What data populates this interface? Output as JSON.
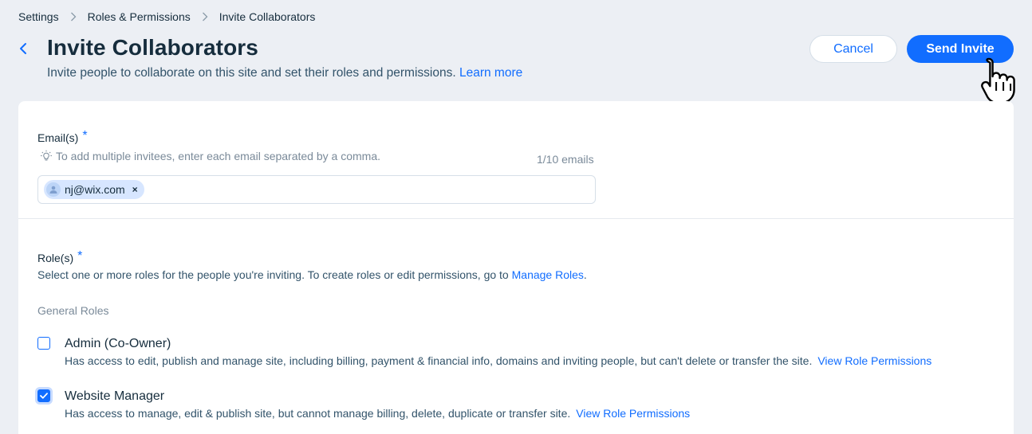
{
  "breadcrumb": [
    "Settings",
    "Roles & Permissions",
    "Invite Collaborators"
  ],
  "header": {
    "title": "Invite Collaborators",
    "subtitle": "Invite people to collaborate on this site and set their roles and permissions.",
    "learn_more": "Learn more",
    "cancel_label": "Cancel",
    "send_label": "Send Invite"
  },
  "emails": {
    "label": "Email(s)",
    "required_mark": "*",
    "hint": "To add multiple invitees, enter each email separated by a comma.",
    "counter": "1/10 emails",
    "chips": [
      "nj@wix.com"
    ],
    "chip_remove": "×"
  },
  "roles": {
    "label": "Role(s)",
    "required_mark": "*",
    "description": "Select one or more roles for the people you're inviting. To create roles or edit permissions, go to",
    "manage_link": "Manage Roles",
    "description_end": ".",
    "group_title": "General Roles",
    "items": [
      {
        "title": "Admin (Co-Owner)",
        "description": "Has access to edit, publish and manage site, including billing, payment & financial info, domains and inviting people, but can't delete or transfer the site.",
        "link": "View Role Permissions",
        "checked": false
      },
      {
        "title": "Website Manager",
        "description": "Has access to manage, edit & publish site, but cannot manage billing, delete, duplicate or transfer site.",
        "link": "View Role Permissions",
        "checked": true
      }
    ]
  },
  "colors": {
    "accent": "#116dff",
    "background": "#eceff4",
    "text": "#162d3d"
  }
}
